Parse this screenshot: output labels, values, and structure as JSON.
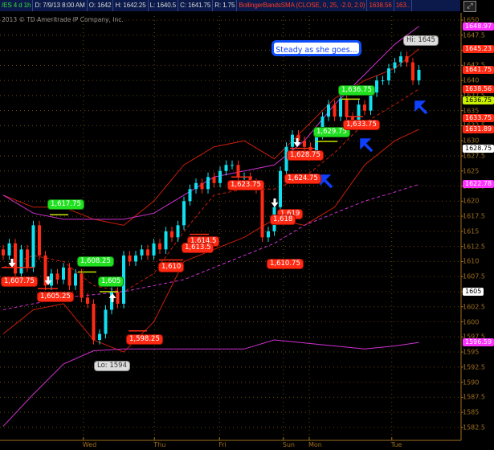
{
  "header": {
    "symbol": "/ES 4 d 1h",
    "date": "D: 7/9/13 8:00 AM",
    "open": "O: 1642",
    "high": "H: 1642.25",
    "low": "L: 1640.5",
    "close": "C: 1641.75",
    "range": "R: 1.75",
    "study": "BollingerBandsSMA (CLOSE, 0, 25, -2.0, 2.0)",
    "study_value": "1638.56",
    "study_value2": "163..",
    "button_icon": "chart-style-icon"
  },
  "copyright": "2013 © TD Ameritrade IP Company, Inc.",
  "callout": "Steady as she goes...",
  "price_tags": [
    {
      "text": "1648.97",
      "price": 1648.97,
      "bg": "#ff33ff",
      "fg": "#ffffff"
    },
    {
      "text": "1645.23",
      "price": 1645.23,
      "bg": "#ff2a14",
      "fg": "#ffffff"
    },
    {
      "text": "1641.75",
      "price": 1641.75,
      "bg": "#ff2a14",
      "fg": "#ffffff"
    },
    {
      "text": "1638.56",
      "price": 1638.56,
      "bg": "#ff2a14",
      "fg": "#ffffff"
    },
    {
      "text": "1636.75",
      "price": 1636.75,
      "bg": "#c8f000",
      "fg": "#000000"
    },
    {
      "text": "1633.75",
      "price": 1633.75,
      "bg": "#ff2a14",
      "fg": "#ffffff"
    },
    {
      "text": "1631.89",
      "price": 1631.89,
      "bg": "#ff2a14",
      "fg": "#ffffff"
    },
    {
      "text": "1628.75",
      "price": 1628.75,
      "bg": "#ffffff",
      "fg": "#000000"
    },
    {
      "text": "1622.78",
      "price": 1622.78,
      "bg": "#ff33ff",
      "fg": "#ffffff"
    },
    {
      "text": "1605",
      "price": 1605,
      "bg": "#ffffff",
      "fg": "#000000"
    },
    {
      "text": "1596.59",
      "price": 1596.59,
      "bg": "#ff33ff",
      "fg": "#ffffff"
    }
  ],
  "annotations": {
    "a1": "1,617.75",
    "a2": "1,607.75",
    "a3": "1,605.25",
    "a4": "1,608.25",
    "a5": "1,605",
    "a6": "1,598.25",
    "a7": "Lo: 1594",
    "a8": "1,610",
    "a9": "1,614.5",
    "a10": "1,613.5",
    "a11": "1,623.75",
    "a12": "1,619",
    "a13": "1,618",
    "a14": "1,610.75",
    "a15": "1,628.75",
    "a16": "1,624.75",
    "a17": "1,629.75",
    "a18": "1,636.75",
    "a19": "1,633.75",
    "a20": "Hi: 1645"
  },
  "chart_data": {
    "type": "candlestick",
    "symbol": "/ES",
    "interval": "1h",
    "ylim": [
      1581,
      1651
    ],
    "y_ticks": [
      "1650",
      "1647.5",
      "1645",
      "1642.5",
      "1640",
      "1637.5",
      "1635",
      "1632.5",
      "1630",
      "1627.5",
      "1625",
      "1622.5",
      "1620",
      "1617.5",
      "1615",
      "1612.5",
      "1610",
      "1607.5",
      "1605",
      "1602.5",
      "1600",
      "1597.5",
      "1595",
      "1592.5",
      "1590",
      "1587.5",
      "1585",
      "1582.5"
    ],
    "x_labels": [
      {
        "label": "Wed",
        "index": 13.3
      },
      {
        "label": "Thu",
        "index": 25.1
      },
      {
        "label": "Fri",
        "index": 35.9
      },
      {
        "label": "Sun",
        "index": 46.5
      },
      {
        "label": "Mon",
        "index": 50.8
      },
      {
        "label": "Tue",
        "index": 64.5
      }
    ],
    "closes": [
      1611,
      1613,
      1608,
      1612,
      1609,
      1616,
      1611,
      1606,
      1608,
      1607,
      1609,
      1606,
      1608,
      1604,
      1603,
      1597,
      1598,
      1602,
      1605,
      1603,
      1611,
      1610,
      1611,
      1612,
      1611,
      1613,
      1612,
      1615,
      1614,
      1616,
      1620,
      1622,
      1623,
      1622,
      1624,
      1623,
      1625,
      1626,
      1626,
      1624,
      1624,
      1623,
      1622,
      1614,
      1615,
      1619,
      1625,
      1629,
      1631,
      1630,
      1629,
      1628,
      1631,
      1634,
      1636,
      1634,
      1637,
      1634,
      1633,
      1636,
      1635,
      1638,
      1640,
      1640,
      1642,
      1643,
      1644,
      1643,
      1640,
      1641.75
    ],
    "series_index": [
      0,
      5,
      10,
      15,
      20,
      25,
      30,
      35,
      40,
      45,
      50,
      55,
      60,
      65,
      69
    ],
    "series": [
      {
        "name": "Bollinger Upper",
        "color": "#c81e0a",
        "style": "solid",
        "values": [
          1621,
          1619,
          1619,
          1617,
          1616,
          1620,
          1626,
          1629,
          1630,
          1627,
          1632,
          1637,
          1640,
          1642,
          1645.23
        ]
      },
      {
        "name": "Bollinger Mid",
        "color": "#c81e0a",
        "style": "dashed",
        "values": [
          1609,
          1611,
          1610,
          1606,
          1605,
          1608,
          1615,
          1621,
          1622,
          1622,
          1624,
          1628,
          1633,
          1636,
          1638.56
        ]
      },
      {
        "name": "Bollinger Lower",
        "color": "#c81e0a",
        "style": "solid",
        "values": [
          1598,
          1602,
          1603,
          1597,
          1595,
          1600,
          1610,
          1612,
          1614,
          1617,
          1616,
          1619,
          1626,
          1630,
          1631.89
        ]
      },
      {
        "name": "SMA fast",
        "color": "#d030d0",
        "style": "solid",
        "values": [
          1621,
          1618,
          1617,
          1617,
          1617,
          1618,
          1621,
          1624,
          1625,
          1626,
          1630,
          1636,
          1641,
          1646,
          1648.97
        ]
      },
      {
        "name": "SMA slow",
        "color": "#d030d0",
        "style": "dashed",
        "values": [
          1602,
          1603,
          1604,
          1604.5,
          1605,
          1606,
          1607,
          1609,
          1611,
          1613,
          1616,
          1618,
          1620,
          1621.5,
          1622.78
        ]
      },
      {
        "name": "SMA long",
        "color": "#d030d0",
        "style": "solid",
        "values": [
          1582.7,
          1588,
          1593,
          1595.2,
          1595.5,
          1595.5,
          1595.5,
          1595.5,
          1595.5,
          1597,
          1596.5,
          1596,
          1595.5,
          1596,
          1596.59
        ]
      }
    ]
  }
}
